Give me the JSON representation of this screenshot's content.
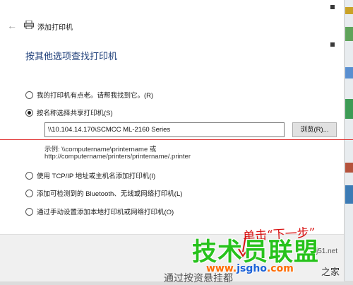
{
  "window": {
    "title": "添加打印机",
    "back_icon": "back-arrow-icon",
    "printer_icon": "printer-icon"
  },
  "heading": "按其他选项查找打印机",
  "options": [
    {
      "label": "我的打印机有点老。请帮我找到它。(R)",
      "selected": false
    },
    {
      "label": "按名称选择共享打印机(S)",
      "selected": true
    },
    {
      "label": "使用 TCP/IP 地址或主机名添加打印机(I)",
      "selected": false
    },
    {
      "label": "添加可检测到的 Bluetooth、无线或网络打印机(L)",
      "selected": false
    },
    {
      "label": "通过手动设置添加本地打印机或网络打印机(O)",
      "selected": false
    }
  ],
  "shared_printer": {
    "value": "\\\\10.104.14.170\\SCMCC ML-2160 Series",
    "browse_label": "浏览(R)...",
    "example_line1": "示例: \\\\computername\\printername 或",
    "example_line2": "http://computername/printers/printername/.printer"
  },
  "annotation": {
    "text": "单击“下一步”",
    "color": "#d81010"
  },
  "watermark": {
    "brand": "技术员联盟",
    "url_prefix": "www.",
    "url_domain": "jsgho",
    "url_suffix": ".com",
    "small_text": "j51.net",
    "zhijia": "之家",
    "brand_color": "#27c21c"
  },
  "bottom_partial_text": "通过按资悬挂都"
}
